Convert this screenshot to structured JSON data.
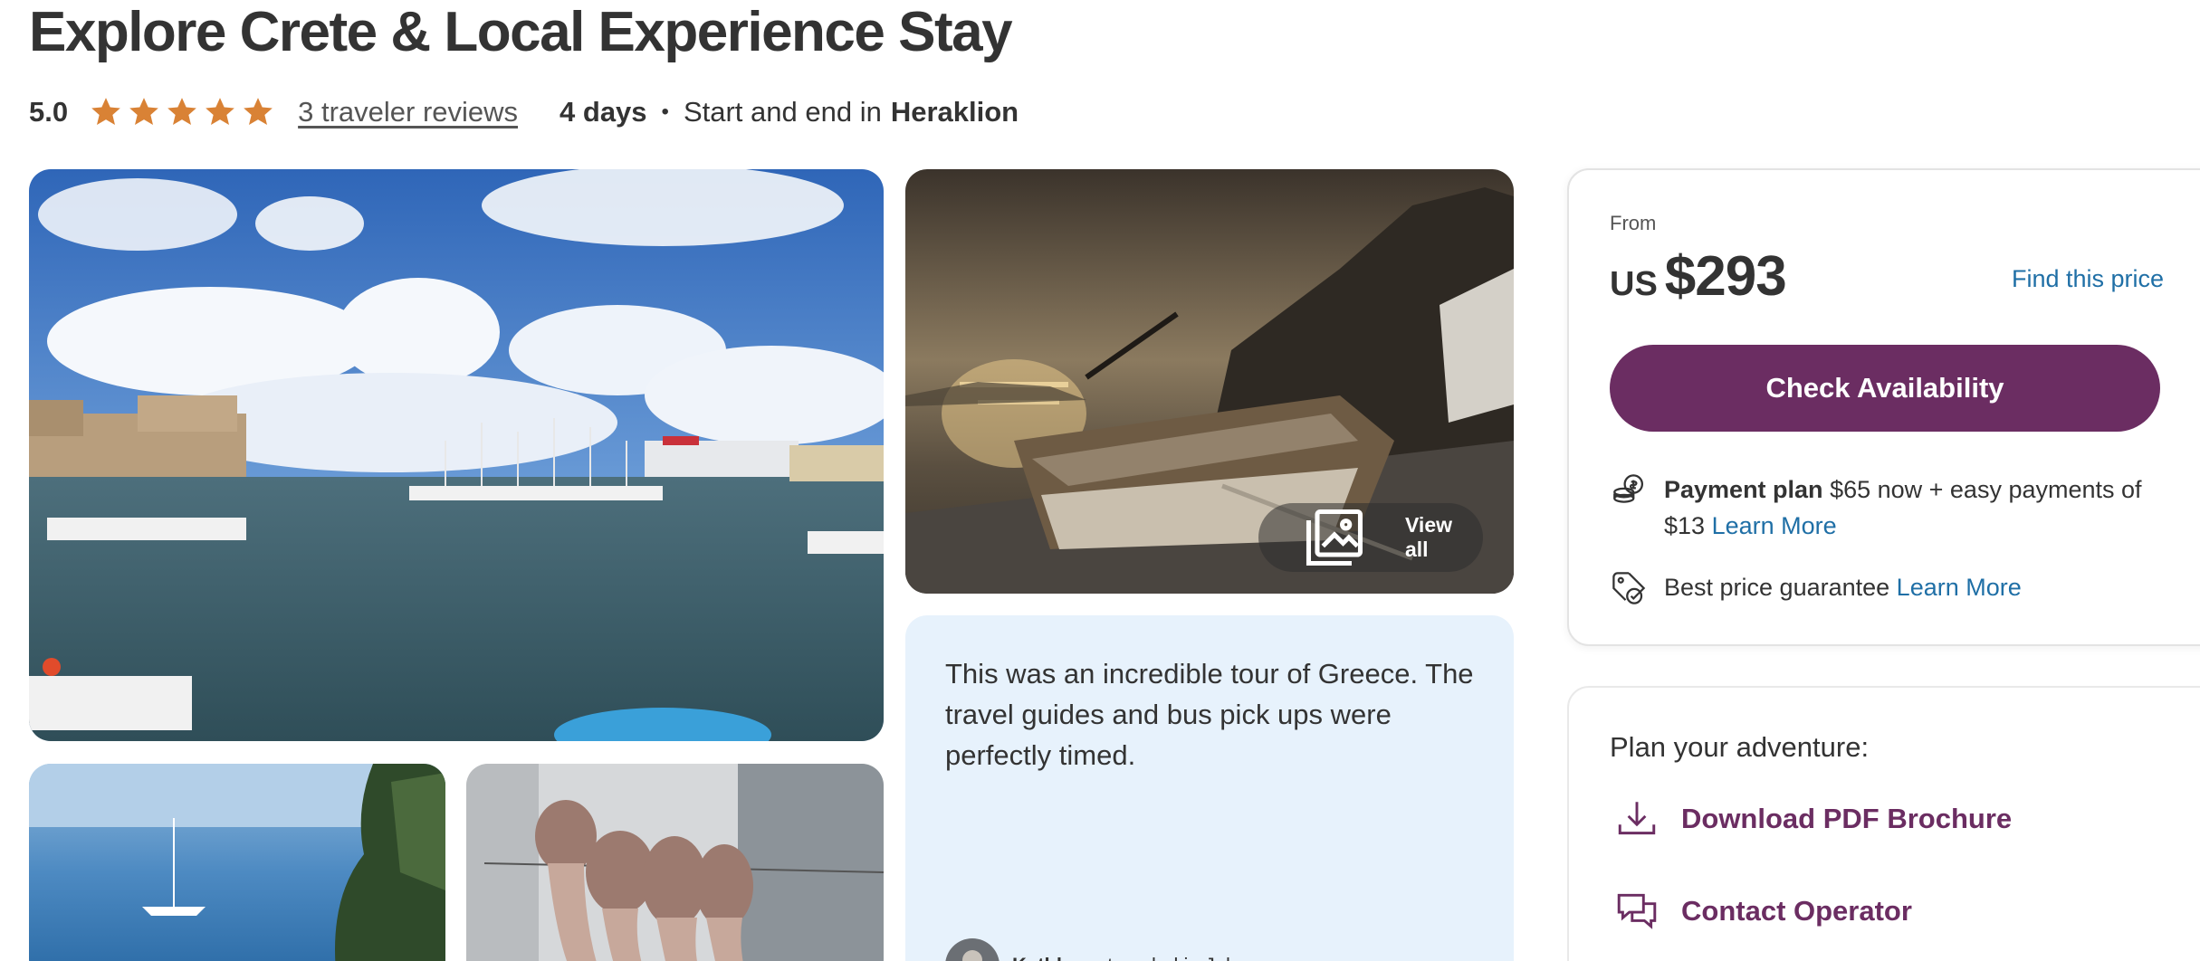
{
  "page": {
    "title": "Explore Crete & Local Experience Stay"
  },
  "meta": {
    "rating": "5.0",
    "stars": 5,
    "reviews_link": "3 traveler reviews",
    "duration": "4 days",
    "separator": "•",
    "start_end_prefix": "Start and end in",
    "city": "Heraklion"
  },
  "gallery": {
    "view_all_label": "View all"
  },
  "review": {
    "text": "This was an incredible tour of Greece. The travel guides and bus pick ups were perfectly timed.",
    "reviewer_name": "Kathleen",
    "reviewer_suffix": ", traveled in July"
  },
  "booking": {
    "from_label": "From",
    "currency": "US",
    "price": "$293",
    "find_price": "Find this price",
    "check_button": "Check Availability",
    "payment_plan_label": "Payment plan",
    "payment_plan_text": " $65 now + easy payments of $13 ",
    "payment_learn_more": "Learn More",
    "guarantee_text": "Best price guarantee ",
    "guarantee_learn_more": "Learn More",
    "accent_color": "#6b2d62",
    "link_color": "#1f6fa6"
  },
  "plan": {
    "title": "Plan your adventure:",
    "download_label": "Download PDF Brochure",
    "contact_label": "Contact Operator"
  },
  "icons": {
    "star": "star-icon",
    "gallery": "gallery-icon",
    "coins": "coins-icon",
    "price_tag": "price-tag-icon",
    "download": "download-icon",
    "chat": "chat-icon"
  }
}
